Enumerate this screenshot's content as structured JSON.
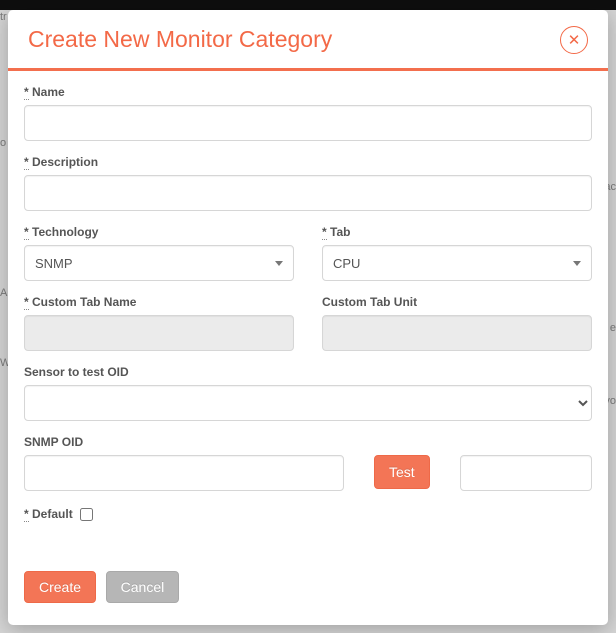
{
  "modal": {
    "title": "Create New Monitor Category"
  },
  "fields": {
    "name": {
      "label": "Name",
      "value": ""
    },
    "description": {
      "label": "Description",
      "value": ""
    },
    "technology": {
      "label": "Technology",
      "selected": "SNMP"
    },
    "tab": {
      "label": "Tab",
      "selected": "CPU"
    },
    "custom_tab_name": {
      "label": "Custom Tab Name",
      "value": ""
    },
    "custom_tab_unit": {
      "label": "Custom Tab Unit",
      "value": ""
    },
    "sensor_oid": {
      "label": "Sensor to test OID",
      "selected": ""
    },
    "snmp_oid": {
      "label": "SNMP OID",
      "value": "",
      "result": ""
    },
    "default": {
      "label": "Default",
      "checked": false
    },
    "required_marker": "*"
  },
  "buttons": {
    "test": "Test",
    "create": "Create",
    "cancel": "Cancel"
  },
  "bg": {
    "top_left": "tr",
    "r1": "o",
    "r2": "ac",
    "r3": "A",
    "r4": "e",
    "r5": "W",
    "r6": "vo"
  }
}
